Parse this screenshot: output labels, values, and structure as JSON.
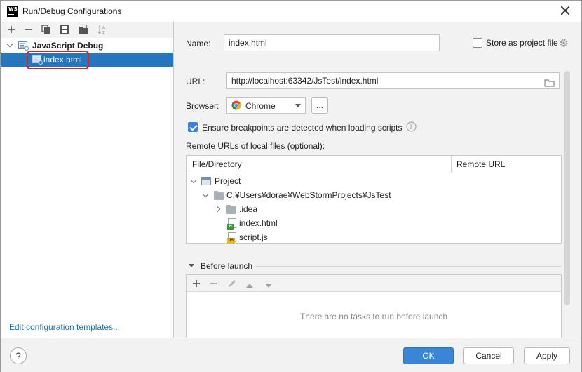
{
  "window": {
    "title": "Run/Debug Configurations",
    "app_icon_text": "WS"
  },
  "left_panel": {
    "toolbar": [
      "add",
      "remove",
      "copy",
      "save",
      "move-to-folder",
      "sort"
    ],
    "tree": [
      {
        "label": "JavaScript Debug",
        "expanded": true
      },
      {
        "label": "index.html",
        "selected": true
      }
    ],
    "edit_templates_link": "Edit configuration templates..."
  },
  "form": {
    "name_label": "Name:",
    "name_value": "index.html",
    "store_label": "Store as project file",
    "store_checked": false,
    "url_label": "URL:",
    "url_value": "http://localhost:63342/JsTest/index.html",
    "browser_label": "Browser:",
    "browser_value": "Chrome",
    "browse_button": "...",
    "ensure_label": "Ensure breakpoints are detected when loading scripts",
    "ensure_checked": true,
    "remote_label": "Remote URLs of local files (optional):"
  },
  "remote_table": {
    "columns": [
      "File/Directory",
      "Remote URL"
    ],
    "rows": [
      {
        "label": "Project",
        "icon": "project-icon",
        "depth": 0,
        "chevron": "down"
      },
      {
        "label": "C:¥Users¥dorae¥WebStormProjects¥JsTest",
        "icon": "folder-icon",
        "depth": 1,
        "chevron": "down"
      },
      {
        "label": ".idea",
        "icon": "folder-icon",
        "depth": 2,
        "chevron": "right"
      },
      {
        "label": "index.html",
        "icon": "html-file-icon",
        "depth": 2,
        "chevron": ""
      },
      {
        "label": "script.js",
        "icon": "js-file-icon",
        "depth": 2,
        "chevron": ""
      }
    ]
  },
  "before_launch": {
    "title": "Before launch",
    "empty_text": "There are no tasks to run before launch"
  },
  "buttons": {
    "help": "?",
    "ok": "OK",
    "cancel": "Cancel",
    "apply": "Apply"
  },
  "colors": {
    "selection": "#2675bf",
    "primary_button": "#3a86d6",
    "link": "#2470b3",
    "highlight_box": "#e0201f"
  }
}
